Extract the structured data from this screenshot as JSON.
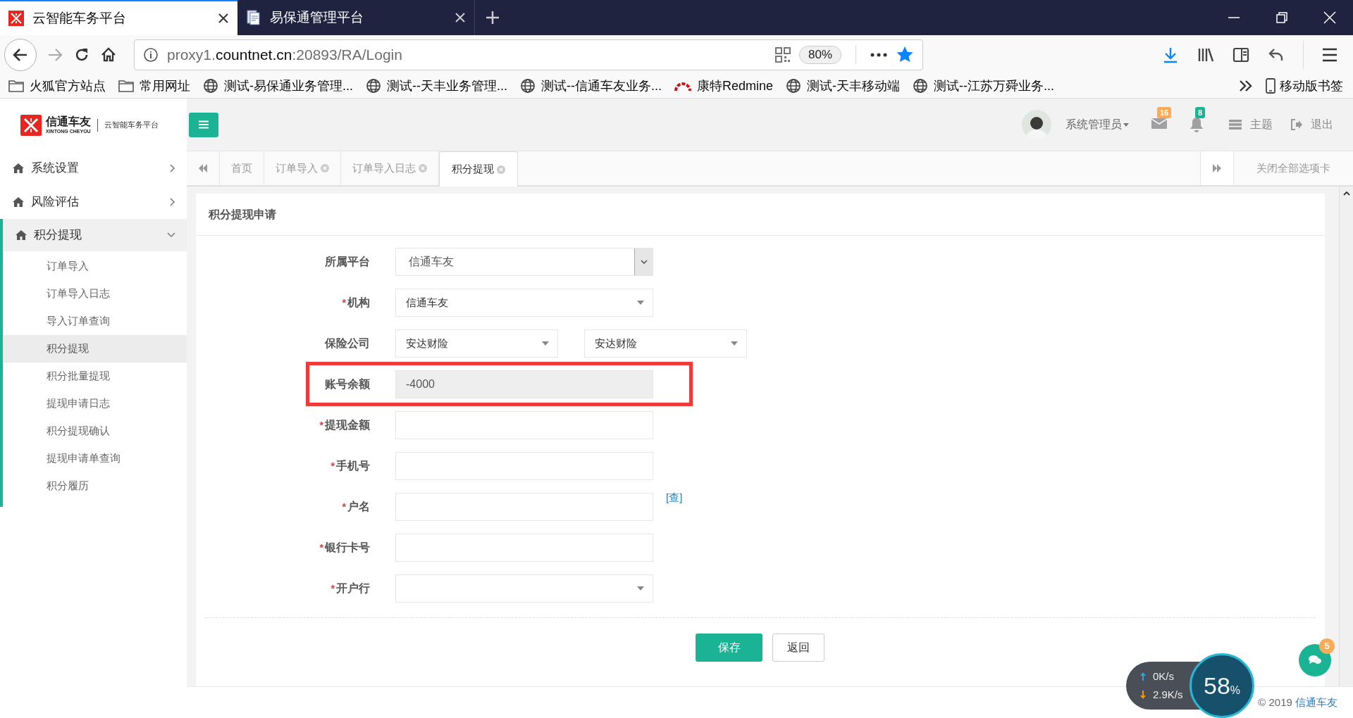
{
  "browser": {
    "tabs": [
      {
        "title": "云智能车务平台",
        "selected": true
      },
      {
        "title": "易保通管理平台",
        "selected": false
      }
    ],
    "url": {
      "prefix": "proxy1.",
      "domain": "countnet.cn",
      "rest": ":20893/RA/Login"
    },
    "zoom": "80%",
    "bookmarks": [
      {
        "label": "火狐官方站点",
        "kind": "folder"
      },
      {
        "label": "常用网址",
        "kind": "folder"
      },
      {
        "label": "测试-易保通业务管理...",
        "kind": "site"
      },
      {
        "label": "测试--天丰业务管理...",
        "kind": "site"
      },
      {
        "label": "测试--信通车友业务...",
        "kind": "site"
      },
      {
        "label": "康特Redmine",
        "kind": "redmine"
      },
      {
        "label": "测试-天丰移动端",
        "kind": "site"
      },
      {
        "label": "测试--江苏万舜业务...",
        "kind": "site"
      }
    ],
    "mobile_bookmarks": "移动版书签"
  },
  "logo": {
    "name": "信通车友",
    "latin": "XINTONG CHEYOU",
    "platform": "云智能车务平台"
  },
  "sidebar": [
    {
      "label": "系统设置",
      "expanded": false
    },
    {
      "label": "风险评估",
      "expanded": false
    },
    {
      "label": "积分提现",
      "expanded": true,
      "children": [
        {
          "label": "订单导入",
          "selected": false
        },
        {
          "label": "订单导入日志",
          "selected": false
        },
        {
          "label": "导入订单查询",
          "selected": false
        },
        {
          "label": "积分提现",
          "selected": true
        },
        {
          "label": "积分批量提现",
          "selected": false
        },
        {
          "label": "提现申请日志",
          "selected": false
        },
        {
          "label": "积分提现确认",
          "selected": false
        },
        {
          "label": "提现申请单查询",
          "selected": false
        },
        {
          "label": "积分履历",
          "selected": false
        }
      ]
    }
  ],
  "header": {
    "user": "系统管理员",
    "mail_count": "16",
    "bell_count": "8",
    "theme": "主题",
    "logout": "退出"
  },
  "page_tabs": {
    "tabs": [
      {
        "label": "首页",
        "closable": false,
        "selected": false
      },
      {
        "label": "订单导入",
        "closable": true,
        "selected": false
      },
      {
        "label": "订单导入日志",
        "closable": true,
        "selected": false
      },
      {
        "label": "积分提现",
        "closable": true,
        "selected": true
      }
    ],
    "close_all": "关闭全部选项卡"
  },
  "form": {
    "title": "积分提现申请",
    "fields": [
      {
        "label": "所属平台",
        "kind": "combo",
        "value": "信通车友",
        "highlighted": false
      },
      {
        "label": "机构",
        "required_mark": "*",
        "kind": "select",
        "value": "信通车友",
        "highlighted": false
      },
      {
        "label": "保险公司",
        "kind": "select_pair",
        "values": [
          "安达财险",
          "安达财险"
        ],
        "highlighted": false
      },
      {
        "label": "账号余额",
        "kind": "readonly",
        "value": "-4000",
        "highlighted": true
      },
      {
        "label": "提现金额",
        "required_mark": "*",
        "kind": "text",
        "highlighted": false
      },
      {
        "label": "手机号",
        "required_mark": "*",
        "kind": "text",
        "highlighted": false
      },
      {
        "label": "户名",
        "required_mark": "*",
        "kind": "text",
        "link": "[查]",
        "highlighted": false
      },
      {
        "label": "银行卡号",
        "required_mark": "*",
        "kind": "text",
        "highlighted": false
      },
      {
        "label": "开户行",
        "required_mark": "*",
        "kind": "select",
        "highlighted": false
      }
    ],
    "buttons": [
      {
        "label": "保存",
        "kind": "primary"
      },
      {
        "label": "返回",
        "kind": "default"
      }
    ]
  },
  "footer": {
    "copyright": "© 2019",
    "company": "信通车友"
  },
  "chat": {
    "badge": "5"
  },
  "speed_widget": {
    "upload": "0K/s",
    "download": "2.9K/s",
    "percent": "58",
    "unit": "%"
  }
}
